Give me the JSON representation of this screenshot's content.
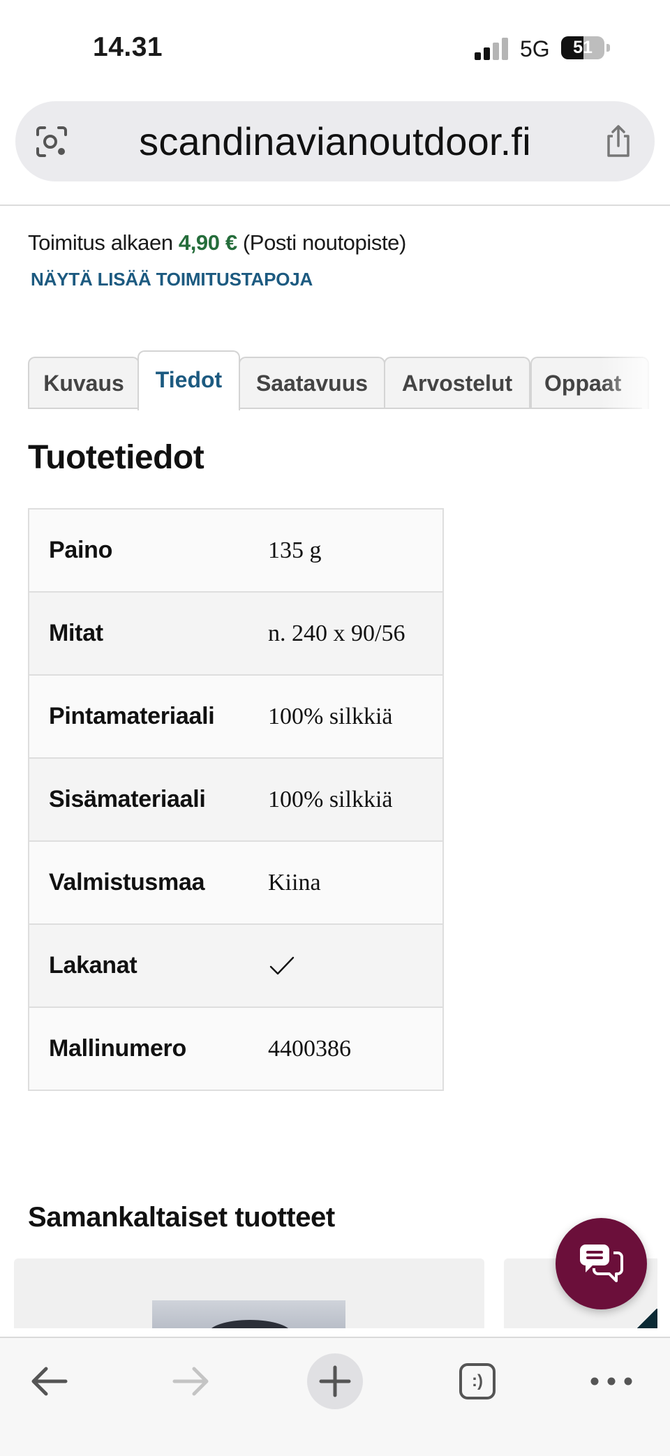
{
  "status_bar": {
    "time": "14.31",
    "network": "5G",
    "battery_percent": "51",
    "battery_level": 0.51
  },
  "browser": {
    "url": "scandinavianoutdoor.fi",
    "tab_switcher_label": ":)"
  },
  "delivery": {
    "prefix": "Toimitus alkaen ",
    "price": "4,90 €",
    "suffix": " (Posti noutopiste)",
    "more_link": "NÄYTÄ LISÄÄ TOIMITUSTAPOJA"
  },
  "tabs": [
    {
      "label": "Kuvaus",
      "active": false
    },
    {
      "label": "Tiedot",
      "active": true
    },
    {
      "label": "Saatavuus",
      "active": false
    },
    {
      "label": "Arvostelut",
      "active": false
    },
    {
      "label": "Oppaat",
      "active": false
    }
  ],
  "product_details": {
    "title": "Tuotetiedot",
    "rows": [
      {
        "key": "Paino",
        "value": "135 g"
      },
      {
        "key": "Mitat",
        "value": "n. 240 x 90/56"
      },
      {
        "key": "Pintamateriaali",
        "value": "100% silkkiä"
      },
      {
        "key": "Sisämateriaali",
        "value": "100% silkkiä"
      },
      {
        "key": "Valmistusmaa",
        "value": "Kiina"
      },
      {
        "key": "Lakanat",
        "value": "",
        "icon": "checkmark-icon"
      },
      {
        "key": "Mallinumero",
        "value": "4400386"
      }
    ]
  },
  "similar_products": {
    "title": "Samankaltaiset tuotteet"
  },
  "colors": {
    "link": "#1c5a80",
    "price": "#256d3b",
    "chat_button": "#6b0f3a"
  },
  "icons": {
    "lens": "camera-lens-icon",
    "share": "share-icon",
    "chat": "chat-bubbles-icon",
    "back": "arrow-left-icon",
    "forward": "arrow-right-icon",
    "new_tab": "plus-icon",
    "tabs": "tab-switcher-icon",
    "menu": "more-dots-icon"
  }
}
